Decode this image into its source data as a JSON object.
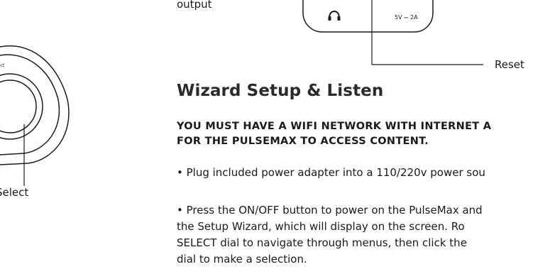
{
  "labels": {
    "output": "output",
    "headphone_icon": "headphone-icon",
    "power_spec": "5V ⎓ 2A",
    "reset": "Reset",
    "select_small": "ect",
    "select": "Select"
  },
  "section": {
    "title": "Wizard Setup & Listen",
    "warning_line1": "YOU MUST HAVE A WIFI NETWORK WITH INTERNET A",
    "warning_line2": "FOR THE PULSEMAX TO ACCESS CONTENT.",
    "step1": "• Plug included power adapter into a 110/220v power sou",
    "step2_line1": "• Press the ON/OFF button to power on the PulseMax and",
    "step2_line2": "the Setup Wizard, which will display on the screen. Ro",
    "step2_line3": "SELECT dial to navigate through menus, then click the",
    "step2_line4": "dial to make a selection."
  }
}
